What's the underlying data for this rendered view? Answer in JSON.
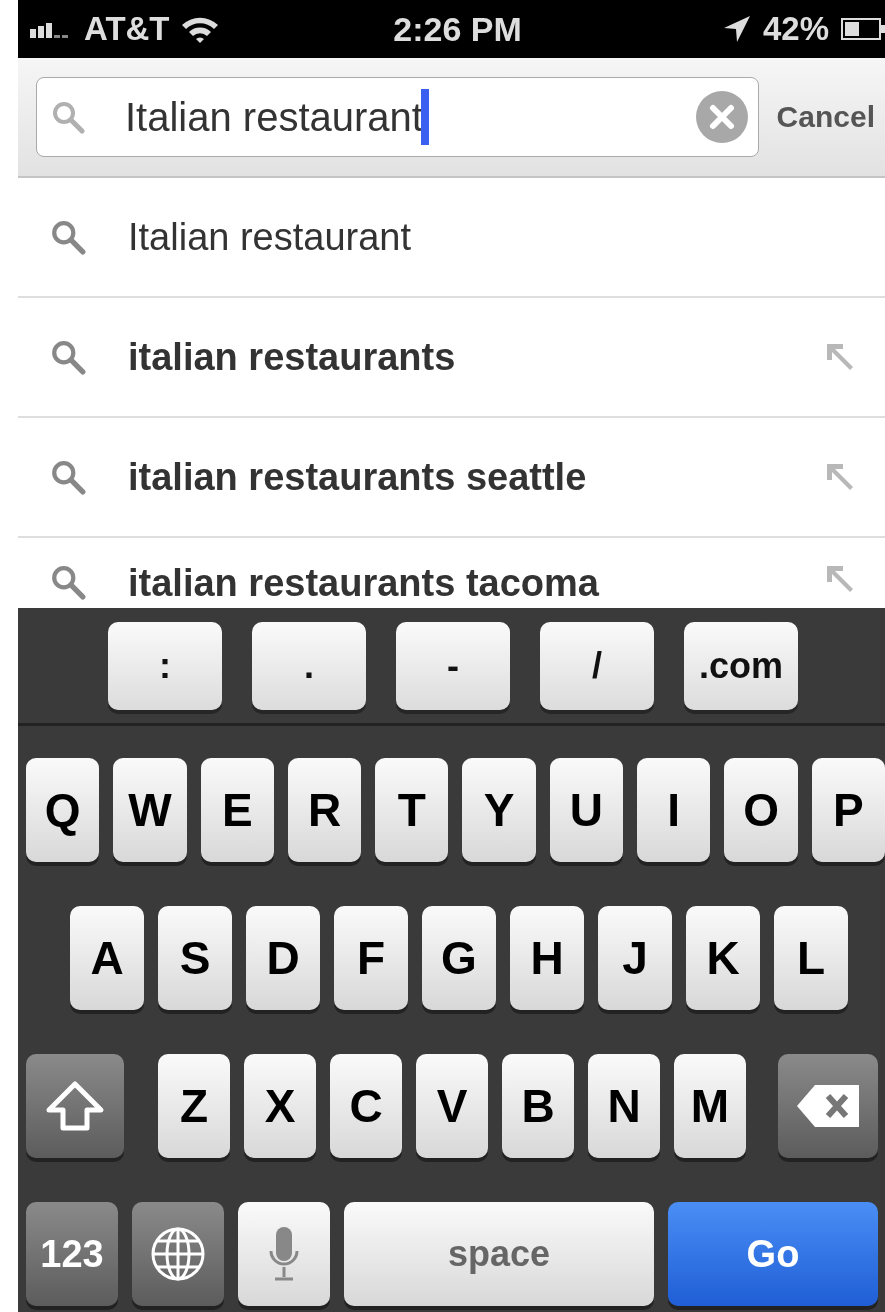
{
  "status_bar": {
    "carrier": "AT&T",
    "time": "2:26 PM",
    "battery": "42%"
  },
  "search": {
    "value": "Italian restaurant",
    "cancel": "Cancel"
  },
  "suggestions": [
    {
      "text": "Italian restaurant",
      "kind": "typed"
    },
    {
      "text": "italian restaurants",
      "kind": "suggestion"
    },
    {
      "text": "italian restaurants seattle",
      "kind": "suggestion"
    },
    {
      "text": "italian restaurants tacoma",
      "kind": "suggestion"
    }
  ],
  "keyboard": {
    "accessory": [
      ":",
      ".",
      "-",
      "/",
      ".com"
    ],
    "top_letter_row": [
      {
        "kind": "letter",
        "label": "Q"
      },
      {
        "kind": "letter",
        "label": "W"
      },
      {
        "kind": "letter",
        "label": "E"
      },
      {
        "kind": "letter",
        "label": "R"
      },
      {
        "kind": "letter",
        "label": "T"
      },
      {
        "kind": "letter",
        "label": "Y"
      },
      {
        "kind": "letter",
        "label": "U"
      },
      {
        "kind": "letter",
        "label": "I"
      },
      {
        "kind": "letter",
        "label": "O"
      },
      {
        "kind": "letter",
        "label": "P"
      }
    ],
    "middle_letter_row": [
      {
        "kind": "letter",
        "label": "A"
      },
      {
        "kind": "letter",
        "label": "S"
      },
      {
        "kind": "letter",
        "label": "D"
      },
      {
        "kind": "letter",
        "label": "F"
      },
      {
        "kind": "letter",
        "label": "G"
      },
      {
        "kind": "letter",
        "label": "H"
      },
      {
        "kind": "letter",
        "label": "J"
      },
      {
        "kind": "letter",
        "label": "K"
      },
      {
        "kind": "letter",
        "label": "L"
      }
    ],
    "bottom_letter_row": [
      {
        "kind": "shift"
      },
      {
        "kind": "letter",
        "label": "Z"
      },
      {
        "kind": "letter",
        "label": "X"
      },
      {
        "kind": "letter",
        "label": "C"
      },
      {
        "kind": "letter",
        "label": "V"
      },
      {
        "kind": "letter",
        "label": "B"
      },
      {
        "kind": "letter",
        "label": "N"
      },
      {
        "kind": "letter",
        "label": "M"
      },
      {
        "kind": "backspace"
      }
    ],
    "function_row": [
      {
        "kind": "mode",
        "label": "123"
      },
      {
        "kind": "globe"
      },
      {
        "kind": "mic"
      },
      {
        "kind": "space",
        "label": "space"
      },
      {
        "kind": "go",
        "label": "Go"
      }
    ]
  }
}
